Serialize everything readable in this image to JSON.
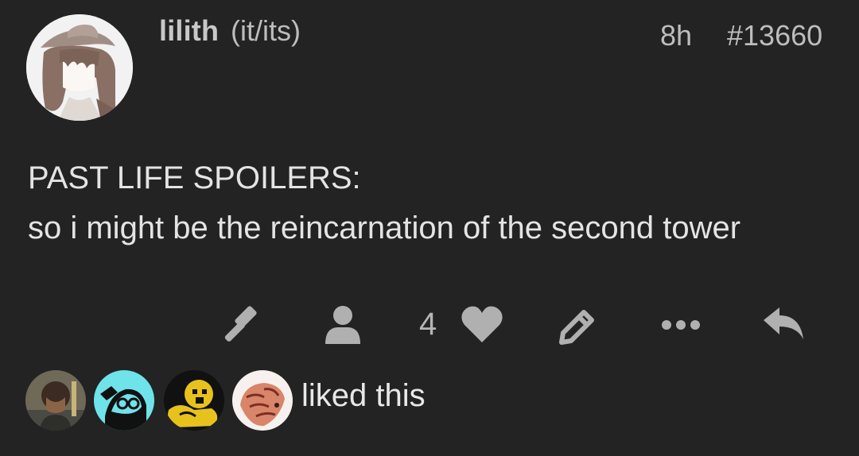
{
  "post": {
    "author": {
      "username": "lilith",
      "pronouns": "(it/its)",
      "avatar_icon": "user-avatar"
    },
    "time_ago": "8h",
    "post_number": "#13660",
    "body_lines": [
      "PAST LIFE SPOILERS:",
      "so i might be the reincarnation of the second tower"
    ],
    "actions": {
      "like_count": "4",
      "icons": [
        "gavel-icon",
        "user-icon",
        "heart-icon",
        "pencil-icon",
        "more-icon",
        "reply-icon"
      ]
    },
    "likes": {
      "text": "liked this",
      "avatars": [
        "liker-avatar-1",
        "liker-avatar-2",
        "liker-avatar-3",
        "liker-avatar-4"
      ]
    }
  },
  "colors": {
    "background": "#232323",
    "text": "#e4e4e4",
    "muted": "#bdbdbd",
    "icon": "#b0b0b0"
  }
}
